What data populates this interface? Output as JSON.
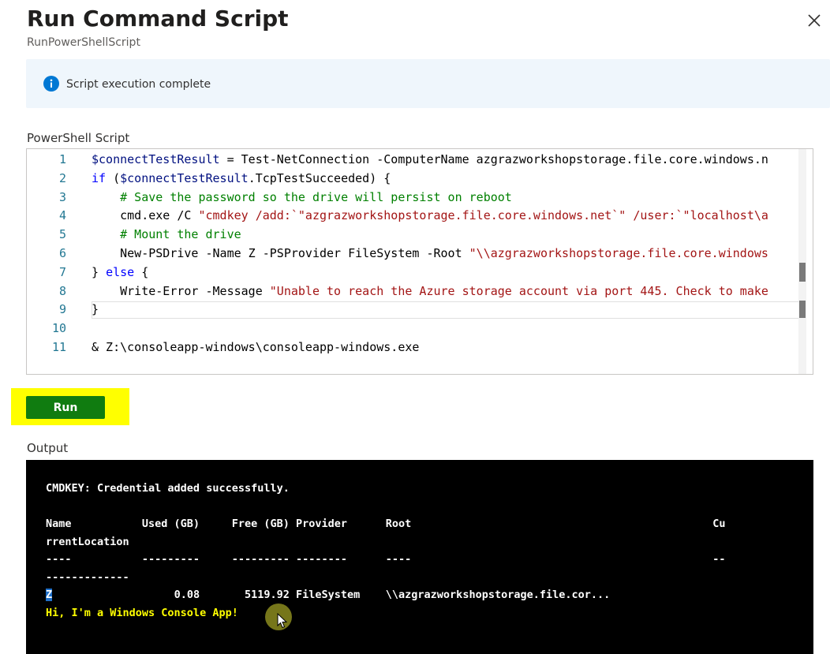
{
  "panel": {
    "title": "Run Command Script",
    "subtitle": "RunPowerShellScript",
    "close_icon": "close-icon"
  },
  "info": {
    "icon": "info-icon",
    "message": "Script execution complete",
    "accent": "#0078d4"
  },
  "script": {
    "label": "PowerShell Script",
    "lines": [
      {
        "n": "1",
        "text": "$connectTestResult = Test-NetConnection -ComputerName azgrazworkshopstorage.file.core.windows.n"
      },
      {
        "n": "2",
        "text": "if ($connectTestResult.TcpTestSucceeded) {"
      },
      {
        "n": "3",
        "text": "    # Save the password so the drive will persist on reboot"
      },
      {
        "n": "4",
        "text": "    cmd.exe /C \"cmdkey /add:`\"azgrazworkshopstorage.file.core.windows.net`\" /user:`\"localhost\\a"
      },
      {
        "n": "5",
        "text": "    # Mount the drive"
      },
      {
        "n": "6",
        "text": "    New-PSDrive -Name Z -PSProvider FileSystem -Root \"\\\\azgrazworkshopstorage.file.core.windows"
      },
      {
        "n": "7",
        "text": "} else {"
      },
      {
        "n": "8",
        "text": "    Write-Error -Message \"Unable to reach the Azure storage account via port 445. Check to make"
      },
      {
        "n": "9",
        "text": "}"
      },
      {
        "n": "10",
        "text": ""
      },
      {
        "n": "11",
        "text": "& Z:\\consoleapp-windows\\consoleapp-windows.exe"
      }
    ]
  },
  "run": {
    "label": "Run",
    "color": "#107c10",
    "highlight": "#ffff00"
  },
  "output": {
    "label": "Output",
    "lines": [
      {
        "text": "CMDKEY: Credential added successfully.",
        "style": "white"
      },
      {
        "text": "",
        "style": "white"
      },
      {
        "text": "Name           Used (GB)     Free (GB) Provider      Root                                               Cu",
        "style": "white"
      },
      {
        "text": "rrentLocation",
        "style": "white"
      },
      {
        "text": "----           ---------     --------- --------      ----                                               --",
        "style": "white"
      },
      {
        "text": "-------------",
        "style": "white"
      },
      {
        "text": "                    0.08       5119.92 FileSystem    \\\\azgrazworkshopstorage.file.cor...",
        "style": "white",
        "selected_prefix": "Z"
      },
      {
        "text": "Hi, I'm a Windows Console App!",
        "style": "yellow"
      }
    ]
  }
}
